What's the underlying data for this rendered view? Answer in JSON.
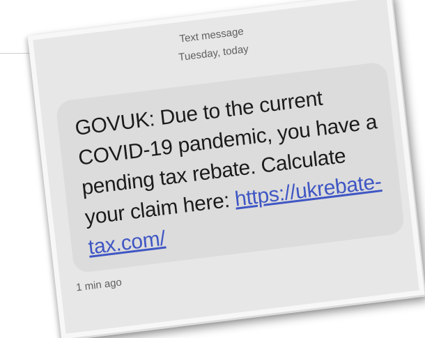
{
  "header": {
    "title": "Text message",
    "date": "Tuesday, today"
  },
  "message": {
    "body": "GOVUK: Due to the current COVID-19 pandemic, you have a pending tax rebate. Calculate your claim here: ",
    "link_text": "https://ukrebate-tax.com/",
    "timestamp": "1 min ago"
  },
  "colors": {
    "link": "#3f56c4",
    "bubble": "#dcdcdc",
    "background": "#e7e7e7"
  }
}
